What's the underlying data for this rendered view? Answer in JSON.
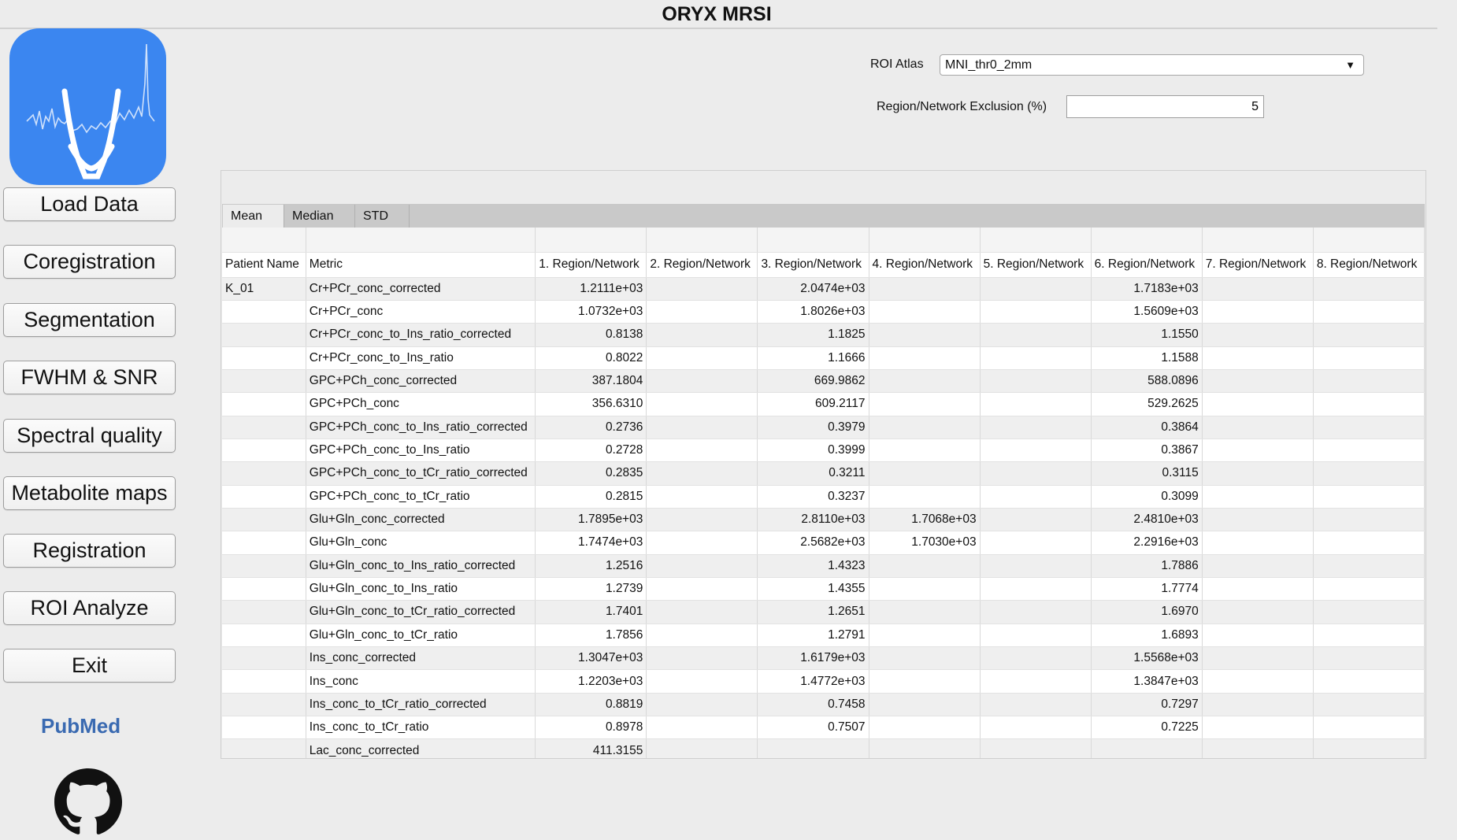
{
  "app": {
    "title": "ORYX MRSI"
  },
  "sidebar": {
    "buttons": [
      "Load Data",
      "Coregistration",
      "Segmentation",
      "FWHM & SNR",
      "Spectral quality",
      "Metabolite maps",
      "Registration",
      "ROI Analyze",
      "Exit"
    ],
    "pubmed_label": "PubMed"
  },
  "form": {
    "atlas_label": "ROI Atlas",
    "atlas_value": "MNI_thr0_2mm",
    "exclusion_label": "Region/Network Exclusion (%)",
    "exclusion_value": "5"
  },
  "tabs": [
    "Mean",
    "Median",
    "STD"
  ],
  "table": {
    "headers": [
      "Patient Name",
      "Metric",
      "1. Region/Network",
      "2. Region/Network",
      "3. Region/Network",
      "4. Region/Network",
      "5. Region/Network",
      "6. Region/Network",
      "7. Region/Network",
      "8. Region/Network"
    ],
    "rows": [
      [
        "K_01",
        "Cr+PCr_conc_corrected",
        "1.2111e+03",
        "",
        "2.0474e+03",
        "",
        "",
        "1.7183e+03",
        "",
        ""
      ],
      [
        "",
        "Cr+PCr_conc",
        "1.0732e+03",
        "",
        "1.8026e+03",
        "",
        "",
        "1.5609e+03",
        "",
        ""
      ],
      [
        "",
        "Cr+PCr_conc_to_Ins_ratio_corrected",
        "0.8138",
        "",
        "1.1825",
        "",
        "",
        "1.1550",
        "",
        ""
      ],
      [
        "",
        "Cr+PCr_conc_to_Ins_ratio",
        "0.8022",
        "",
        "1.1666",
        "",
        "",
        "1.1588",
        "",
        ""
      ],
      [
        "",
        "GPC+PCh_conc_corrected",
        "387.1804",
        "",
        "669.9862",
        "",
        "",
        "588.0896",
        "",
        ""
      ],
      [
        "",
        "GPC+PCh_conc",
        "356.6310",
        "",
        "609.2117",
        "",
        "",
        "529.2625",
        "",
        ""
      ],
      [
        "",
        "GPC+PCh_conc_to_Ins_ratio_corrected",
        "0.2736",
        "",
        "0.3979",
        "",
        "",
        "0.3864",
        "",
        ""
      ],
      [
        "",
        "GPC+PCh_conc_to_Ins_ratio",
        "0.2728",
        "",
        "0.3999",
        "",
        "",
        "0.3867",
        "",
        ""
      ],
      [
        "",
        "GPC+PCh_conc_to_tCr_ratio_corrected",
        "0.2835",
        "",
        "0.3211",
        "",
        "",
        "0.3115",
        "",
        ""
      ],
      [
        "",
        "GPC+PCh_conc_to_tCr_ratio",
        "0.2815",
        "",
        "0.3237",
        "",
        "",
        "0.3099",
        "",
        ""
      ],
      [
        "",
        "Glu+Gln_conc_corrected",
        "1.7895e+03",
        "",
        "2.8110e+03",
        "1.7068e+03",
        "",
        "2.4810e+03",
        "",
        ""
      ],
      [
        "",
        "Glu+Gln_conc",
        "1.7474e+03",
        "",
        "2.5682e+03",
        "1.7030e+03",
        "",
        "2.2916e+03",
        "",
        ""
      ],
      [
        "",
        "Glu+Gln_conc_to_Ins_ratio_corrected",
        "1.2516",
        "",
        "1.4323",
        "",
        "",
        "1.7886",
        "",
        ""
      ],
      [
        "",
        "Glu+Gln_conc_to_Ins_ratio",
        "1.2739",
        "",
        "1.4355",
        "",
        "",
        "1.7774",
        "",
        ""
      ],
      [
        "",
        "Glu+Gln_conc_to_tCr_ratio_corrected",
        "1.7401",
        "",
        "1.2651",
        "",
        "",
        "1.6970",
        "",
        ""
      ],
      [
        "",
        "Glu+Gln_conc_to_tCr_ratio",
        "1.7856",
        "",
        "1.2791",
        "",
        "",
        "1.6893",
        "",
        ""
      ],
      [
        "",
        "Ins_conc_corrected",
        "1.3047e+03",
        "",
        "1.6179e+03",
        "",
        "",
        "1.5568e+03",
        "",
        ""
      ],
      [
        "",
        "Ins_conc",
        "1.2203e+03",
        "",
        "1.4772e+03",
        "",
        "",
        "1.3847e+03",
        "",
        ""
      ],
      [
        "",
        "Ins_conc_to_tCr_ratio_corrected",
        "0.8819",
        "",
        "0.7458",
        "",
        "",
        "0.7297",
        "",
        ""
      ],
      [
        "",
        "Ins_conc_to_tCr_ratio",
        "0.8978",
        "",
        "0.7507",
        "",
        "",
        "0.7225",
        "",
        ""
      ],
      [
        "",
        "Lac_conc_corrected",
        "411.3155",
        "",
        "",
        "",
        "",
        "",
        "",
        ""
      ]
    ]
  }
}
